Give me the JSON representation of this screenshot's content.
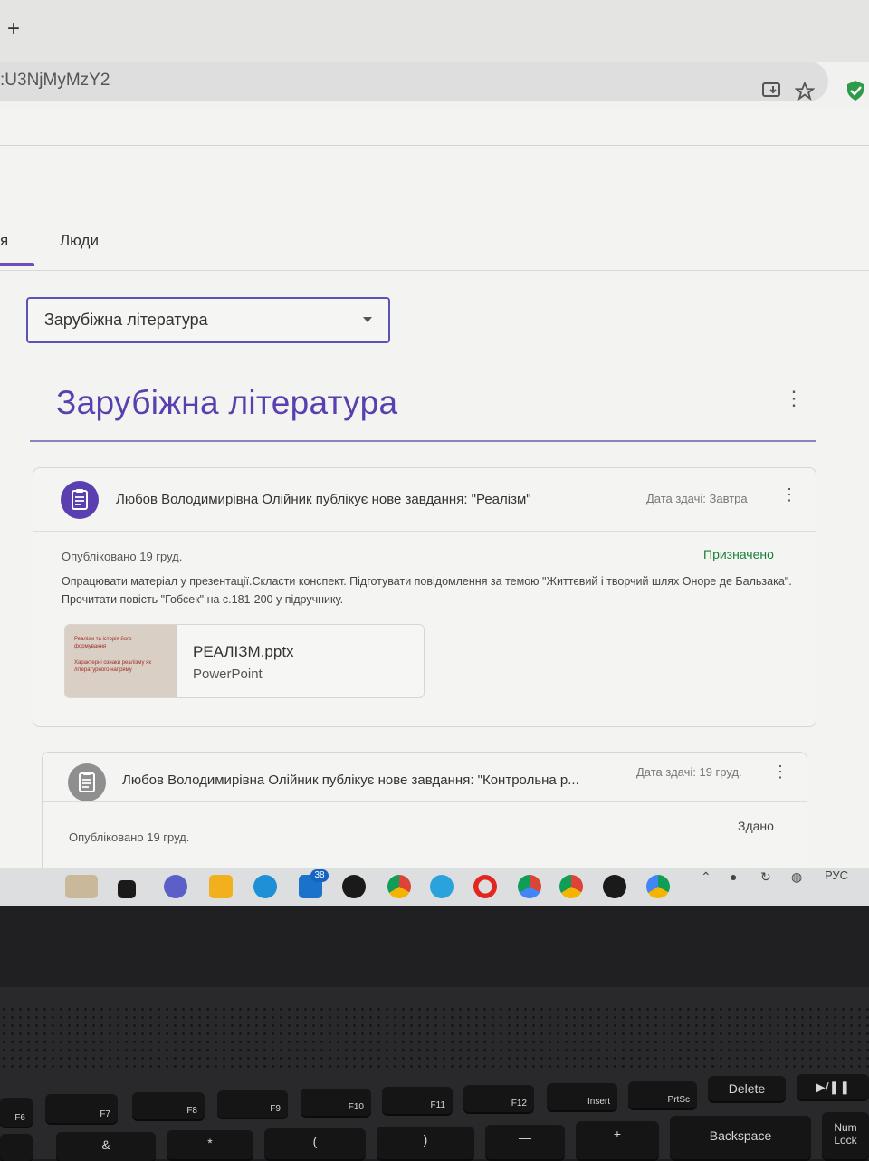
{
  "browser": {
    "new_tab_glyph": "+",
    "url_fragment": ":U3NjMyMzY2",
    "icons": [
      "install-icon",
      "star-icon",
      "shield-extension-icon"
    ]
  },
  "tabs": {
    "partial_label": "я",
    "people_label": "Люди"
  },
  "topic_select": {
    "value": "Зарубіжна література"
  },
  "topic_header": {
    "title": "Зарубіжна література"
  },
  "assignments": [
    {
      "title": "Любов Володимирівна Олійник публікує нове завдання: \"Реалізм\"",
      "due": "Дата здачі: Завтра",
      "published": "Опубліковано 19 груд.",
      "status": "Призначено",
      "status_color": "#188038",
      "description": "Опрацювати матеріал у презентації.Скласти конспект. Підготувати повідомлення за темою \"Життєвий і творчий шлях Оноре де Бальзака\". Прочитати повість \"Гобсек\" на с.181-200 у підручнику.",
      "attachment": {
        "name": "РЕАЛІЗМ.pptx",
        "type": "PowerPoint",
        "thumb_line1": "Реалізм та історія його формування",
        "thumb_line2": "Характерні ознаки реалізму як літературного напряму"
      }
    },
    {
      "title": "Любов Володимирівна Олійник публікує нове завдання: \"Контрольна р...",
      "due": "Дата здачі: 19 груд.",
      "published": "Опубліковано 19 груд.",
      "status": "Здано",
      "status_color": "#444444"
    }
  ],
  "taskbar": {
    "mail_badge": "38",
    "language": "РУС",
    "icons": [
      "widget-icon",
      "taskview-icon",
      "chat-icon",
      "explorer-icon",
      "edge-icon",
      "mail-icon",
      "w-app-icon",
      "chrome-icon",
      "telegram-icon",
      "opera-icon",
      "chrome-icon",
      "chrome-icon",
      "w-app-icon",
      "chrome-icon"
    ]
  },
  "keyboard": {
    "fkeys": [
      "F6",
      "F7",
      "F8",
      "F9",
      "F10",
      "F11",
      "F12",
      "Insert",
      "PrtSc",
      "Delete"
    ],
    "delete_label": "Delete",
    "backspace_label": "Backspace",
    "numlock_label": "Num Lock",
    "symbols": [
      "&",
      "*",
      "(",
      ")",
      "—",
      "+",
      "="
    ]
  }
}
